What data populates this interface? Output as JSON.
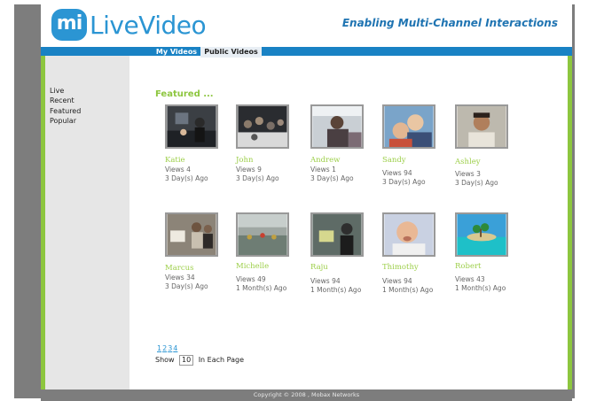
{
  "brand": {
    "logo_badge": "mi",
    "logo_text": "LiveVideo",
    "tagline": "Enabling Multi-Channel Interactions",
    "color": "#2b95d3"
  },
  "tabs": [
    {
      "label": "My Videos"
    },
    {
      "label": "Public Videos",
      "active": true
    }
  ],
  "sidebar": {
    "items": [
      {
        "label": "Live"
      },
      {
        "label": "Recent"
      },
      {
        "label": "Featured"
      },
      {
        "label": "Popular"
      }
    ]
  },
  "main": {
    "section_title": "Featured ...",
    "videos": [
      {
        "name": "Katie",
        "views": "Views  4",
        "age": "3 Day(s) Ago"
      },
      {
        "name": "John",
        "views": "Views 9",
        "age": "3 Day(s) Ago"
      },
      {
        "name": "Andrew",
        "views": "Views 1",
        "age": "3 Day(s) Ago"
      },
      {
        "name": "Sandy",
        "views": "Views 94",
        "age": "3 Day(s) Ago"
      },
      {
        "name": "Ashley",
        "views": "Views 3",
        "age": "3 Day(s) Ago"
      },
      {
        "name": "Marcus",
        "views": "Views 34",
        "age": "3 Day(s) Ago"
      },
      {
        "name": "Michelle",
        "views": "Views 49",
        "age": "1 Month(s) Ago"
      },
      {
        "name": "Raju",
        "views": "Views 94",
        "age": "1 Month(s) Ago"
      },
      {
        "name": "Thimothy",
        "views": "Views 94",
        "age": "1 Month(s) Ago"
      },
      {
        "name": "Robert",
        "views": "Views 43",
        "age": "1 Month(s) Ago"
      }
    ]
  },
  "pagination": {
    "pages": [
      "1",
      "2",
      "3",
      "4"
    ],
    "show_label": "Show",
    "per_page": "10",
    "suffix": "In Each Page"
  },
  "footer": {
    "copyright": "Copyright © 2008 , Mobax Networks"
  },
  "colors": {
    "accent_green": "#8dc63f",
    "nav_blue": "#1982c4",
    "frame_gray": "#7d7d7d"
  }
}
